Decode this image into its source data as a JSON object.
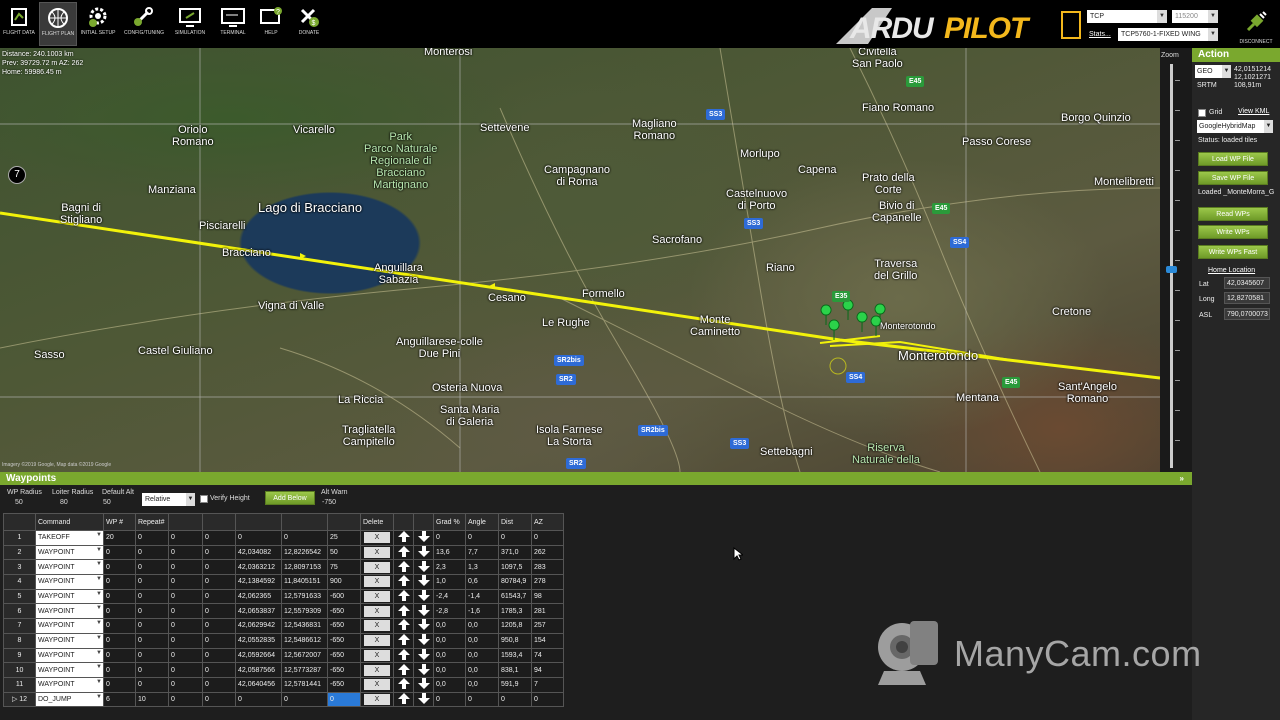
{
  "toolbar": {
    "buttons": [
      {
        "label": "FLIGHT DATA",
        "icon": "flight-data-icon"
      },
      {
        "label": "FLIGHT PLAN",
        "icon": "flight-plan-icon"
      },
      {
        "label": "INITIAL SETUP",
        "icon": "initial-setup-icon"
      },
      {
        "label": "CONFIG/TUNING",
        "icon": "config-tuning-icon"
      },
      {
        "label": "SIMULATION",
        "icon": "simulation-icon"
      },
      {
        "label": "TERMINAL",
        "icon": "terminal-icon"
      },
      {
        "label": "HELP",
        "icon": "help-icon"
      },
      {
        "label": "DONATE",
        "icon": "donate-icon"
      }
    ],
    "logo_text": "ARDUPILOT",
    "connection_type": "TCP",
    "baud_rate": "115200",
    "stats_label": "Stats...",
    "link_name": "TCP5760-1-FIXED WING",
    "disconnect_label": "DISCONNECT",
    "accent_color": "#7aa82e",
    "logo_color": "#f4b81c"
  },
  "map": {
    "info_lines": [
      "Distance: 240.1003 km",
      "Prev: 39729.72 m AZ: 262",
      "Home: 59986.45 m"
    ],
    "copyright": "Imagery ©2019 Google, Map data ©2019 Google",
    "compass_label": "7",
    "places": {
      "monterosi": "Monterosi",
      "civitella": "Civitella\nSan Paolo",
      "oriolo": "Oriolo\nRomano",
      "vicarello": "Vicarello",
      "park": "Park\nParco Naturale\nRegionale di\nBracciano\nMartignano",
      "settevene": "Settevene",
      "magliano": "Magliano\nRomano",
      "fiano": "Fiano Romano",
      "borgo": "Borgo Quinzio",
      "passo": "Passo Corese",
      "manziana": "Manziana",
      "campagnano": "Campagnano\ndi Roma",
      "morlupo": "Morlupo",
      "capena": "Capena",
      "prato": "Prato della\nCorte",
      "montelibretti": "Montelibretti",
      "bagni": "Bagni di\nStigliano",
      "lago": "Lago di Bracciano",
      "pisciarelli": "Pisciarelli",
      "castelnuovo": "Castelnuovo\ndi Porto",
      "bivio": "Bivio di\nCapanelle",
      "bracciano": "Bracciano",
      "anguillara": "Anguillara\nSabazia",
      "sacrofano": "Sacrofano",
      "riano": "Riano",
      "traversa": "Traversa\ndel Grillo",
      "cesano": "Cesano",
      "formello": "Formello",
      "vigna": "Vigna di Valle",
      "lerughe": "Le Rughe",
      "montecaminetto": "Monte\nCaminetto",
      "monterotondo_small": "Monterotondo",
      "monterotondo": "Monterotondo",
      "cretone": "Cretone",
      "sasso": "Sasso",
      "castelgiuliano": "Castel Giuliano",
      "anguillarese": "Anguillarese-colle\nDue Pini",
      "osteria": "Osteria Nuova",
      "santangelo": "Sant'Angelo\nRomano",
      "mentana": "Mentana",
      "lariccia": "La Riccia",
      "santamaria": "Santa Maria\ndi Galeria",
      "tragliatella": "Tragliatella\nCampitello",
      "isolafarnese": "Isola Farnese\nLa Storta",
      "settebagni": "Settebagni",
      "riserva": "Riserva\nNaturale della"
    },
    "roads": {
      "ss3a": "SS3",
      "e45a": "E45",
      "e45b": "E45",
      "ss3b": "SS3",
      "ss4a": "SS4",
      "e35": "E35",
      "sr2bis_a": "SR2bis",
      "sr2": "SR2",
      "ss4b": "SS4",
      "e45c": "E45",
      "sr2bis_b": "SR2bis",
      "ss3c": "SS3",
      "sr2b": "SR2"
    },
    "zoom_label": "Zoom",
    "zoom_level": 0.54
  },
  "action": {
    "title": "Action",
    "coord_system": "GEO",
    "cursor_lat": "42,0151214",
    "cursor_lng": "12,1021271",
    "srtm_label": "SRTM",
    "srtm_alt": "108,91m",
    "grid_label": "Grid",
    "view_kml": "View KML",
    "map_type": "GoogleHybridMap",
    "status": "Status: loaded tiles",
    "load_wp": "Load WP File",
    "save_wp": "Save WP File",
    "loaded_file": "Loaded _MonteMorra_G",
    "read_wps": "Read WPs",
    "write_wps": "Write WPs",
    "write_wps_fast": "Write WPs Fast",
    "home_location": "Home Location",
    "lat_label": "Lat",
    "lat": "42,0345607",
    "long_label": "Long",
    "long": "12,8270581",
    "asl_label": "ASL",
    "asl": "790,0700073"
  },
  "waypoints": {
    "title": "Waypoints",
    "wp_radius_label": "WP Radius",
    "wp_radius": "50",
    "loiter_radius_label": "Loiter Radius",
    "loiter_radius": "80",
    "default_alt_label": "Default Alt",
    "default_alt": "50",
    "frame": "Relative",
    "verify_height": "Verify Height",
    "add_below": "Add Below",
    "alt_warn_label": "Alt Warn",
    "alt_warn": "-750",
    "columns": [
      "",
      "Command",
      "WP #",
      "Repeat#",
      "",
      "",
      "",
      "",
      "",
      "Delete",
      "",
      "",
      "Grad %",
      "Angle",
      "Dist",
      "AZ"
    ],
    "rows": [
      {
        "n": "1",
        "cmd": "TAKEOFF",
        "p1": "20",
        "p2": "0",
        "p3": "0",
        "p4": "0",
        "lat": "0",
        "lng": "0",
        "alt": "25",
        "grad": "0",
        "angle": "0",
        "dist": "0",
        "az": "0"
      },
      {
        "n": "2",
        "cmd": "WAYPOINT",
        "p1": "0",
        "p2": "0",
        "p3": "0",
        "p4": "0",
        "lat": "42,034082",
        "lng": "12,8226542",
        "alt": "50",
        "grad": "13,6",
        "angle": "7,7",
        "dist": "371,0",
        "az": "262"
      },
      {
        "n": "3",
        "cmd": "WAYPOINT",
        "p1": "0",
        "p2": "0",
        "p3": "0",
        "p4": "0",
        "lat": "42,0363212",
        "lng": "12,8097153",
        "alt": "75",
        "grad": "2,3",
        "angle": "1,3",
        "dist": "1097,5",
        "az": "283"
      },
      {
        "n": "4",
        "cmd": "WAYPOINT",
        "p1": "0",
        "p2": "0",
        "p3": "0",
        "p4": "0",
        "lat": "42,1384592",
        "lng": "11,8405151",
        "alt": "900",
        "grad": "1,0",
        "angle": "0,6",
        "dist": "80784,9",
        "az": "278"
      },
      {
        "n": "5",
        "cmd": "WAYPOINT",
        "p1": "0",
        "p2": "0",
        "p3": "0",
        "p4": "0",
        "lat": "42,062365",
        "lng": "12,5791633",
        "alt": "-600",
        "grad": "-2,4",
        "angle": "-1,4",
        "dist": "61543,7",
        "az": "98"
      },
      {
        "n": "6",
        "cmd": "WAYPOINT",
        "p1": "0",
        "p2": "0",
        "p3": "0",
        "p4": "0",
        "lat": "42,0653837",
        "lng": "12,5579309",
        "alt": "-650",
        "grad": "-2,8",
        "angle": "-1,6",
        "dist": "1785,3",
        "az": "281"
      },
      {
        "n": "7",
        "cmd": "WAYPOINT",
        "p1": "0",
        "p2": "0",
        "p3": "0",
        "p4": "0",
        "lat": "42,0629942",
        "lng": "12,5436831",
        "alt": "-650",
        "grad": "0,0",
        "angle": "0,0",
        "dist": "1205,8",
        "az": "257"
      },
      {
        "n": "8",
        "cmd": "WAYPOINT",
        "p1": "0",
        "p2": "0",
        "p3": "0",
        "p4": "0",
        "lat": "42,0552835",
        "lng": "12,5486612",
        "alt": "-650",
        "grad": "0,0",
        "angle": "0,0",
        "dist": "950,8",
        "az": "154"
      },
      {
        "n": "9",
        "cmd": "WAYPOINT",
        "p1": "0",
        "p2": "0",
        "p3": "0",
        "p4": "0",
        "lat": "42,0592664",
        "lng": "12,5672007",
        "alt": "-650",
        "grad": "0,0",
        "angle": "0,0",
        "dist": "1593,4",
        "az": "74"
      },
      {
        "n": "10",
        "cmd": "WAYPOINT",
        "p1": "0",
        "p2": "0",
        "p3": "0",
        "p4": "0",
        "lat": "42,0587566",
        "lng": "12,5773287",
        "alt": "-650",
        "grad": "0,0",
        "angle": "0,0",
        "dist": "838,1",
        "az": "94"
      },
      {
        "n": "11",
        "cmd": "WAYPOINT",
        "p1": "0",
        "p2": "0",
        "p3": "0",
        "p4": "0",
        "lat": "42,0640456",
        "lng": "12,5781441",
        "alt": "-650",
        "grad": "0,0",
        "angle": "0,0",
        "dist": "591,9",
        "az": "7"
      },
      {
        "n": "12",
        "cmd": "DO_JUMP",
        "p1": "6",
        "p2": "10",
        "p3": "0",
        "p4": "0",
        "lat": "0",
        "lng": "0",
        "alt": "0",
        "grad": "0",
        "angle": "0",
        "dist": "0",
        "az": "0"
      }
    ],
    "delete_label": "X"
  },
  "watermark": "ManyCam.com"
}
